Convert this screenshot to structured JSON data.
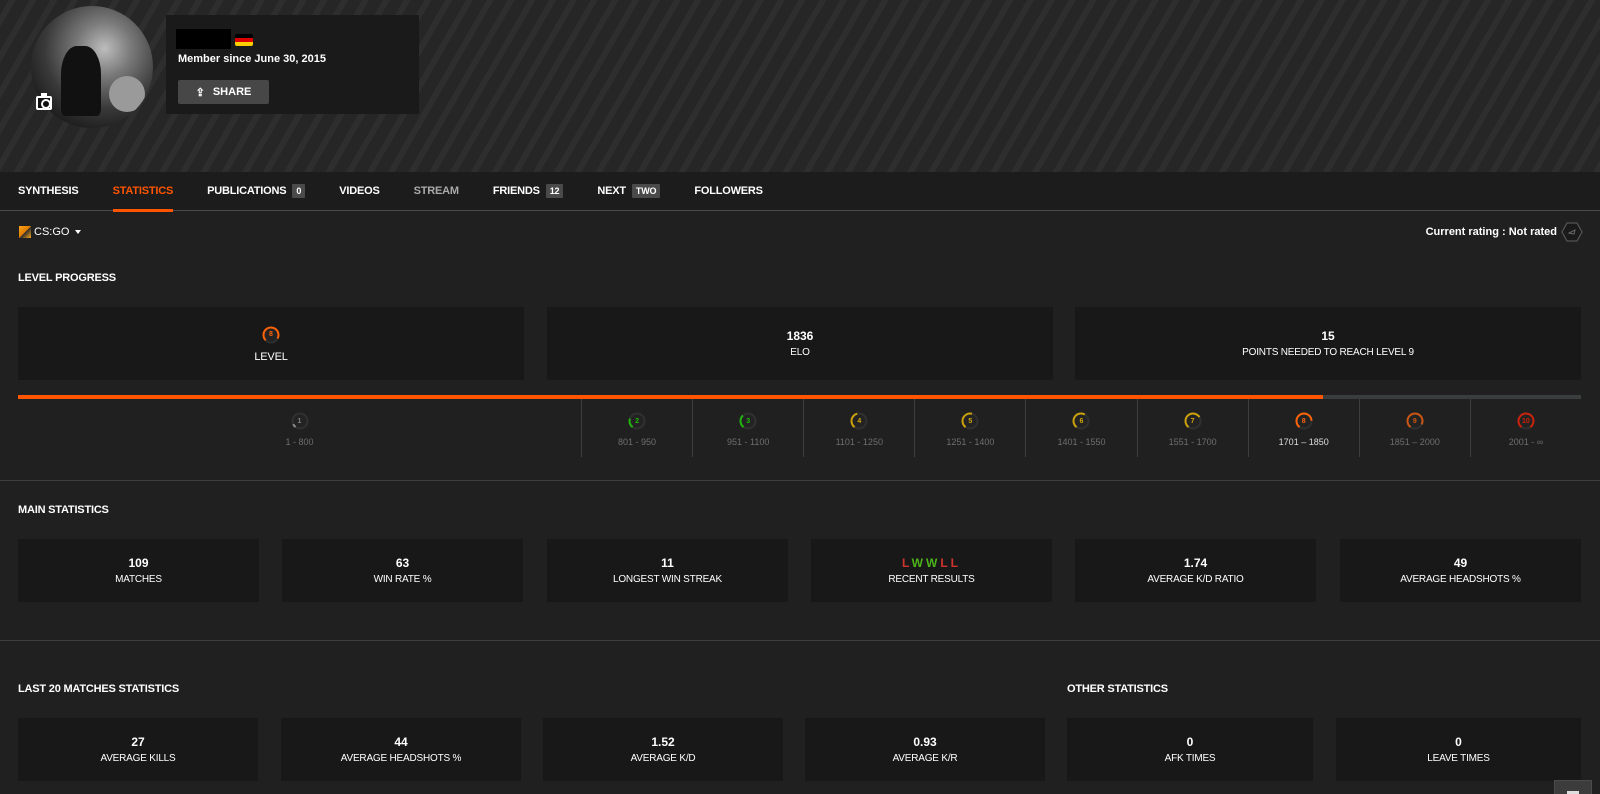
{
  "profile": {
    "member_since": "Member since June 30, 2015",
    "share_label": "SHARE",
    "flag_colors": [
      "#000000",
      "#dd0000",
      "#ffce00"
    ]
  },
  "tabs": [
    {
      "label": "SYNTHESIS",
      "active": false,
      "badge": null
    },
    {
      "label": "STATISTICS",
      "active": true,
      "badge": null
    },
    {
      "label": "PUBLICATIONS",
      "active": false,
      "badge": "0"
    },
    {
      "label": "VIDEOS",
      "active": false,
      "badge": null
    },
    {
      "label": "STREAM",
      "active": false,
      "badge": null,
      "dim": true
    },
    {
      "label": "FRIENDS",
      "active": false,
      "badge": "12"
    },
    {
      "label": "NEXT",
      "active": false,
      "badge": "TWO"
    },
    {
      "label": "FOLLOWERS",
      "active": false,
      "badge": null
    }
  ],
  "game_selector": {
    "label": "CS:GO"
  },
  "rating": {
    "label": "Current rating : Not rated"
  },
  "level_progress": {
    "title": "LEVEL PROGRESS",
    "level": {
      "value": "8",
      "label": "LEVEL"
    },
    "elo": {
      "value": "1836",
      "label": "ELO"
    },
    "points_needed": {
      "value": "15",
      "label": "POINTS NEEDED TO REACH LEVEL 9"
    },
    "progress_fraction": 0.835,
    "levels": [
      {
        "level": "1",
        "range": "1 - 800",
        "color": "#aaaaaa",
        "fill": 0.1
      },
      {
        "level": "2",
        "range": "801 - 950",
        "color": "#1ce400",
        "fill": 0.25
      },
      {
        "level": "3",
        "range": "951 - 1100",
        "color": "#1ce400",
        "fill": 0.35
      },
      {
        "level": "4",
        "range": "1101 - 1250",
        "color": "#ffc800",
        "fill": 0.45
      },
      {
        "level": "5",
        "range": "1251 - 1400",
        "color": "#ffc800",
        "fill": 0.55
      },
      {
        "level": "6",
        "range": "1401 - 1550",
        "color": "#ffc800",
        "fill": 0.6
      },
      {
        "level": "7",
        "range": "1551 - 1700",
        "color": "#ffc800",
        "fill": 0.7
      },
      {
        "level": "8",
        "range": "1701 – 1850",
        "color": "#ff6309",
        "fill": 0.8,
        "current": true
      },
      {
        "level": "9",
        "range": "1851 – 2000",
        "color": "#ff6309",
        "fill": 0.9
      },
      {
        "level": "10",
        "range": "2001 - ∞",
        "color": "#fe1f00",
        "fill": 1.0
      }
    ]
  },
  "main_statistics": {
    "title": "MAIN STATISTICS",
    "items": [
      {
        "value": "109",
        "label": "MATCHES"
      },
      {
        "value": "63",
        "label": "WIN RATE %"
      },
      {
        "value": "11",
        "label": "LONGEST WIN STREAK"
      },
      {
        "value": "",
        "label": "RECENT RESULTS",
        "results": [
          "L",
          "W",
          "W",
          "L",
          "L"
        ]
      },
      {
        "value": "1.74",
        "label": "AVERAGE K/D RATIO"
      },
      {
        "value": "49",
        "label": "AVERAGE HEADSHOTS %"
      }
    ]
  },
  "last20": {
    "title": "LAST 20 MATCHES STATISTICS",
    "items": [
      {
        "value": "27",
        "label": "AVERAGE KILLS"
      },
      {
        "value": "44",
        "label": "AVERAGE HEADSHOTS %"
      },
      {
        "value": "1.52",
        "label": "AVERAGE K/D"
      },
      {
        "value": "0.93",
        "label": "AVERAGE K/R"
      }
    ]
  },
  "other": {
    "title": "OTHER STATISTICS",
    "items": [
      {
        "value": "0",
        "label": "AFK TIMES"
      },
      {
        "value": "0",
        "label": "LEAVE TIMES"
      }
    ]
  },
  "colors": {
    "accent": "#ff5500",
    "win": "#4cb518",
    "loss": "#d0332e"
  }
}
